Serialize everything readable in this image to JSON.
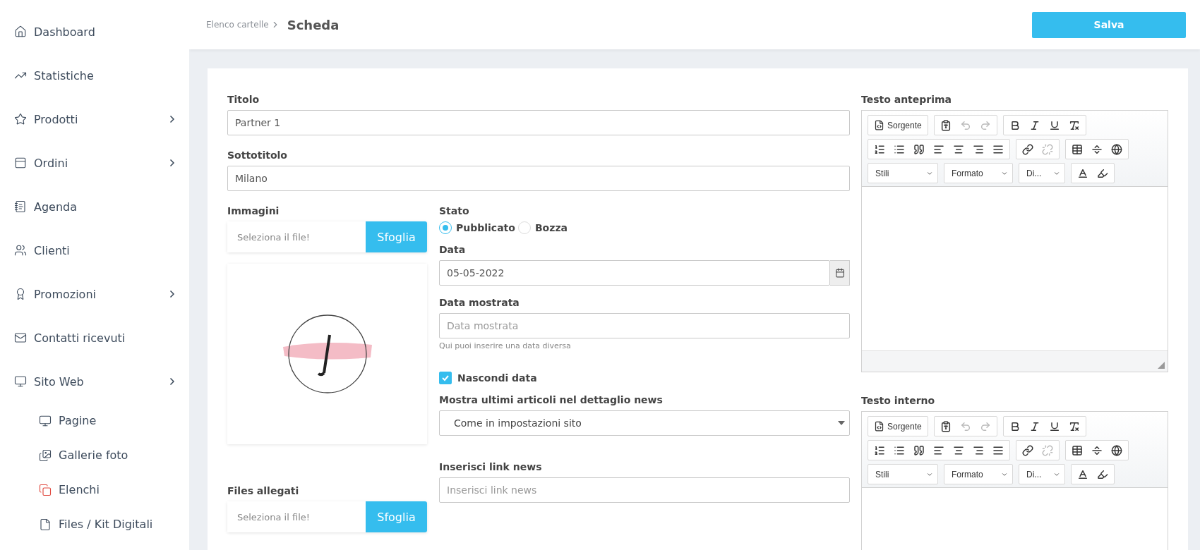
{
  "sidebar": {
    "items": [
      {
        "label": "Dashboard",
        "has_submenu": false,
        "selected": false
      },
      {
        "label": "Statistiche",
        "has_submenu": false,
        "selected": false
      },
      {
        "label": "Prodotti",
        "has_submenu": true,
        "selected": false
      },
      {
        "label": "Ordini",
        "has_submenu": true,
        "selected": false
      },
      {
        "label": "Agenda",
        "has_submenu": false,
        "selected": false
      },
      {
        "label": "Clienti",
        "has_submenu": false,
        "selected": false
      },
      {
        "label": "Promozioni",
        "has_submenu": true,
        "selected": false
      },
      {
        "label": "Contatti ricevuti",
        "has_submenu": false,
        "selected": false
      },
      {
        "label": "Sito Web",
        "has_submenu": true,
        "selected": false,
        "children": [
          {
            "label": "Pagine",
            "selected": false
          },
          {
            "label": "Gallerie foto",
            "selected": false
          },
          {
            "label": "Elenchi",
            "selected": true
          },
          {
            "label": "Files / Kit Digitali",
            "selected": false
          }
        ]
      }
    ]
  },
  "header": {
    "breadcrumb": "Elenco cartelle",
    "title": "Scheda",
    "save_button": "Salva"
  },
  "form": {
    "titolo": {
      "label": "Titolo",
      "value": "Partner 1"
    },
    "sottotitolo": {
      "label": "Sottotitolo",
      "value": "Milano"
    },
    "immagini": {
      "label": "Immagini",
      "placeholder": "Seleziona il file!",
      "button": "Sfoglia"
    },
    "files_allegati": {
      "label": "Files allegati",
      "placeholder": "Seleziona il file!",
      "button": "Sfoglia"
    },
    "stato": {
      "label": "Stato",
      "options": [
        {
          "label": "Pubblicato",
          "selected": true
        },
        {
          "label": "Bozza",
          "selected": false
        }
      ]
    },
    "data": {
      "label": "Data",
      "value": "05-05-2022"
    },
    "data_mostrata": {
      "label": "Data mostrata",
      "placeholder": "Data mostrata",
      "hint": "Qui puoi inserire una data diversa"
    },
    "nascondi_data": {
      "label": "Nascondi data",
      "checked": true
    },
    "mostra_articoli": {
      "label": "Mostra ultimi articoli nel dettaglio news",
      "value": "Come in impostazioni sito"
    },
    "link_news": {
      "label": "Inserisci link news",
      "placeholder": "Inserisci link news"
    }
  },
  "editors": [
    {
      "label": "Testo anteprima",
      "source_button": "Sorgente",
      "undo_disabled": true,
      "redo_disabled": true,
      "unlink_disabled": true,
      "dropdowns": [
        "Stili",
        "Formato",
        "Di..."
      ]
    },
    {
      "label": "Testo interno",
      "source_button": "Sorgente",
      "undo_disabled": true,
      "redo_disabled": true,
      "unlink_disabled": true,
      "dropdowns": [
        "Stili",
        "Formato",
        "Di..."
      ]
    }
  ]
}
